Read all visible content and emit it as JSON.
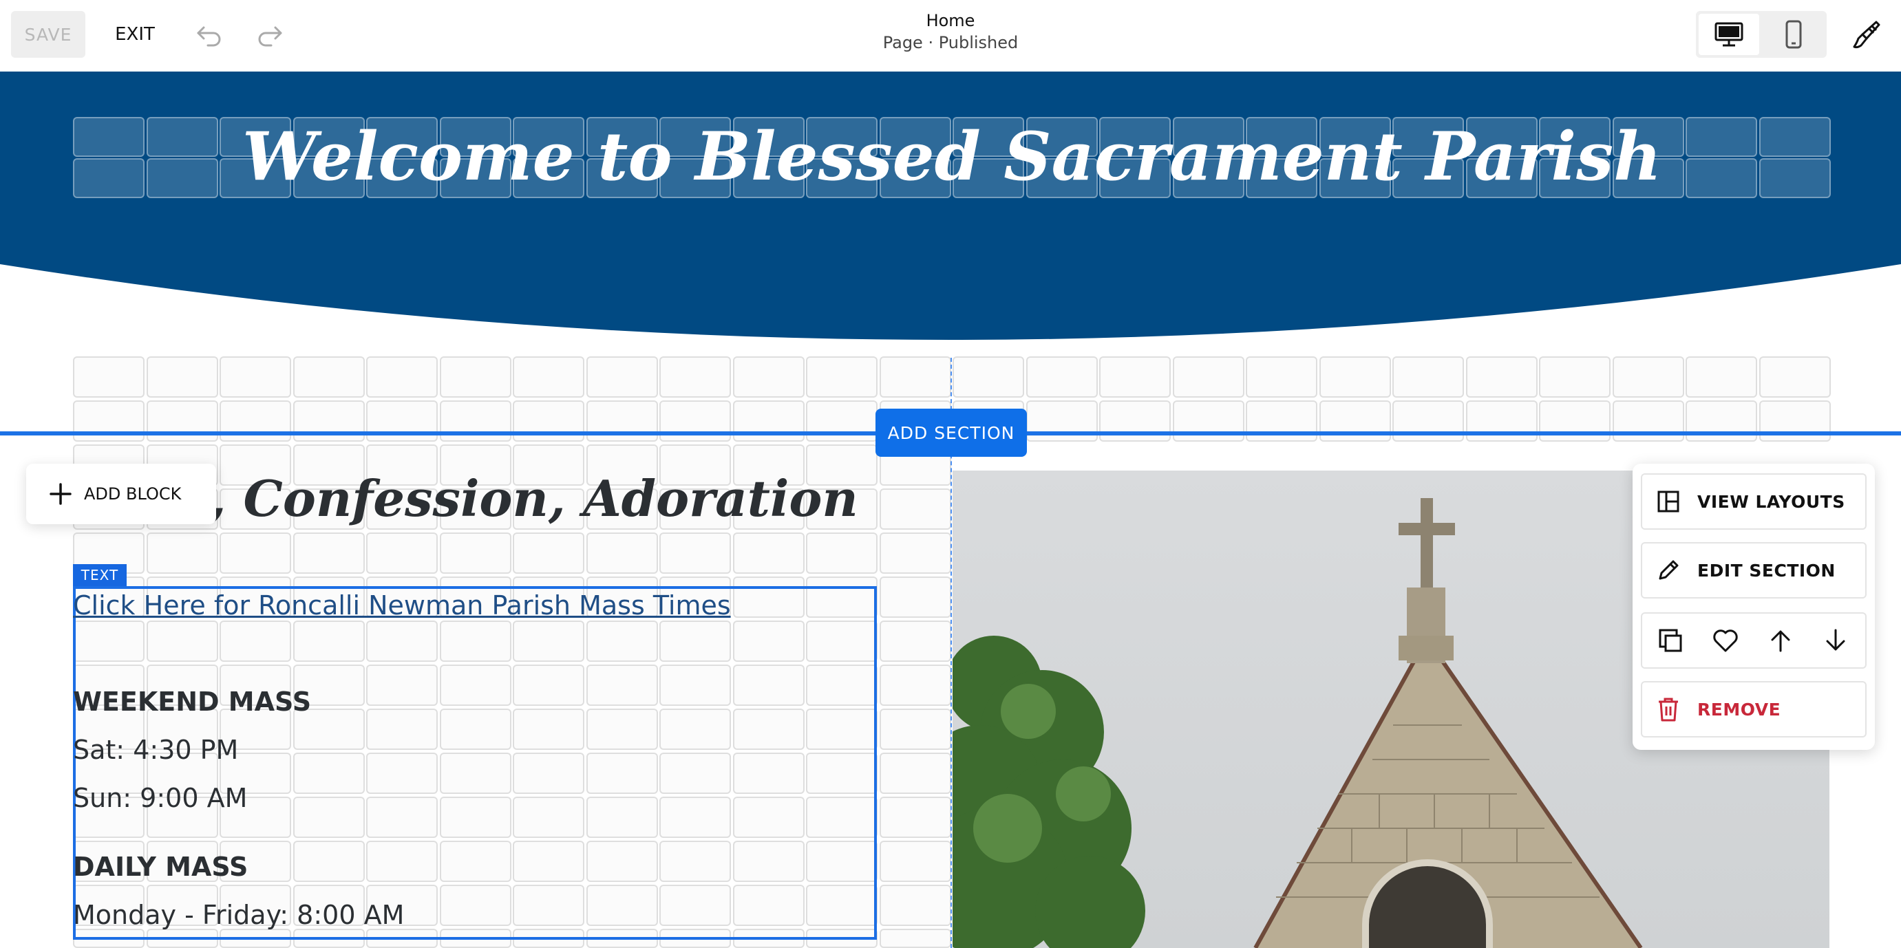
{
  "toolbar": {
    "save_label": "SAVE",
    "exit_label": "EXIT",
    "page_title": "Home",
    "page_status": "Page · Published"
  },
  "banner": {
    "title": "Welcome to Blessed Sacrament Parish",
    "color": "#014a83"
  },
  "editor": {
    "add_section_label": "ADD SECTION",
    "add_block_label": "ADD BLOCK",
    "text_tag": "TEXT",
    "accent": "#0f6fe8"
  },
  "content": {
    "heading": "Mass, Confession, Adoration",
    "link_text": "Click Here for Roncalli Newman Parish Mass Times",
    "weekend_heading": "WEEKEND MASS",
    "weekend_sat": "Sat:  4:30 PM",
    "weekend_sun": "Sun:  9:00 AM",
    "daily_heading": "DAILY MASS",
    "daily_times": "Monday - Friday: 8:00 AM"
  },
  "section_menu": {
    "view_layouts": "VIEW LAYOUTS",
    "edit_section": "EDIT SECTION",
    "remove": "REMOVE",
    "remove_color": "#c8283a"
  },
  "icons": [
    "undo-icon",
    "redo-icon",
    "desktop-icon",
    "mobile-icon",
    "paintbrush-icon",
    "plus-icon",
    "layout-icon",
    "pencil-icon",
    "duplicate-icon",
    "heart-icon",
    "arrow-up-icon",
    "arrow-down-icon",
    "trash-icon"
  ]
}
